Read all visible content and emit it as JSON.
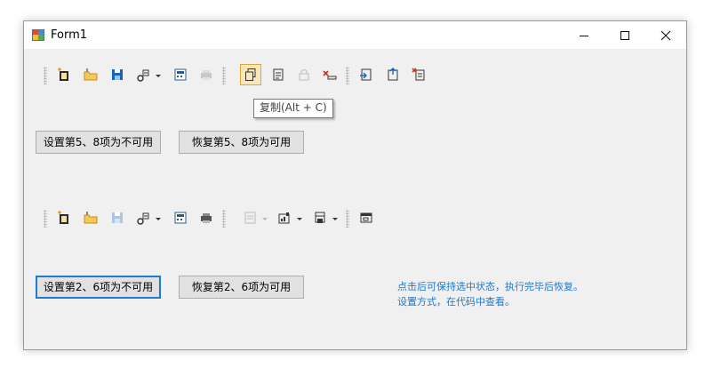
{
  "window": {
    "title": "Form1",
    "controls": {
      "minimize": "—",
      "maximize": "☐",
      "close": "✕"
    }
  },
  "toolbar1": {
    "items": [
      {
        "icon": "new-icon",
        "enabled": true
      },
      {
        "icon": "open-icon",
        "enabled": true
      },
      {
        "icon": "save-icon",
        "enabled": true
      },
      {
        "icon": "settings-dropdown-icon",
        "enabled": true,
        "dropdown": true
      },
      {
        "icon": "calculator-icon",
        "enabled": true
      },
      {
        "icon": "print-icon",
        "enabled": false
      },
      {
        "icon": "copy-icon",
        "enabled": true,
        "hovered": true
      },
      {
        "icon": "paste-icon",
        "enabled": true
      },
      {
        "icon": "lock-icon",
        "enabled": false
      },
      {
        "icon": "delete-icon",
        "enabled": true
      },
      {
        "icon": "import-icon",
        "enabled": true
      },
      {
        "icon": "export-icon",
        "enabled": true
      },
      {
        "icon": "delete-list-icon",
        "enabled": true
      }
    ],
    "tooltip": "复制(Alt + C)"
  },
  "buttons_row1": {
    "disable_label": "设置第5、8项为不可用",
    "restore_label": "恢复第5、8项为可用"
  },
  "toolbar2": {
    "items": [
      {
        "icon": "new-icon",
        "enabled": true
      },
      {
        "icon": "open-icon",
        "enabled": true
      },
      {
        "icon": "save-icon",
        "enabled": false
      },
      {
        "icon": "settings-dropdown-icon",
        "enabled": true,
        "dropdown": true
      },
      {
        "icon": "calculator-icon",
        "enabled": true
      },
      {
        "icon": "print-icon",
        "enabled": true
      },
      {
        "icon": "report-dropdown-icon",
        "enabled": false,
        "dropdown": true
      },
      {
        "icon": "chart-dropdown-icon",
        "enabled": true,
        "dropdown": true
      },
      {
        "icon": "layout-dropdown-icon",
        "enabled": true,
        "dropdown": true
      },
      {
        "icon": "window-icon",
        "enabled": true
      }
    ]
  },
  "buttons_row2": {
    "disable_label": "设置第2、6项为不可用",
    "restore_label": "恢复第2、6项为可用"
  },
  "note": {
    "line1": "点击后可保持选中状态，执行完毕后恢复。",
    "line2": "设置方式，在代码中查看。"
  },
  "colors": {
    "accent": "#1e7bd2",
    "note_text": "#1f78c8",
    "hover_fill": "#fbe6b8"
  }
}
